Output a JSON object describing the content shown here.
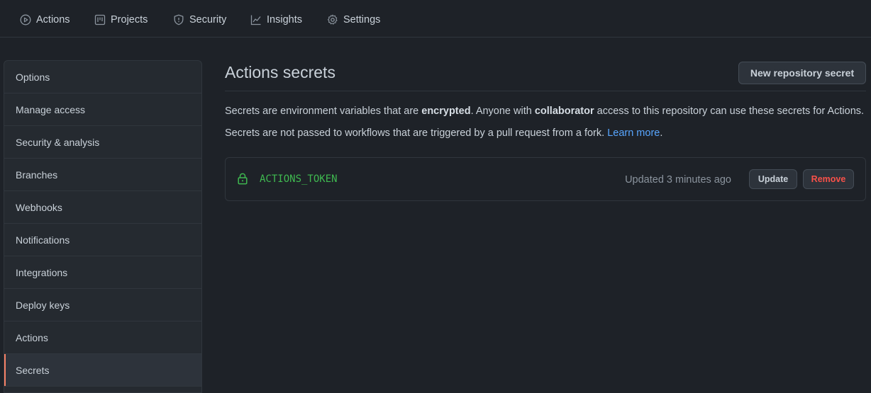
{
  "topnav": {
    "tabs": [
      {
        "label": "Actions",
        "icon": "play-circle-icon"
      },
      {
        "label": "Projects",
        "icon": "project-board-icon"
      },
      {
        "label": "Security",
        "icon": "shield-icon"
      },
      {
        "label": "Insights",
        "icon": "graph-icon"
      },
      {
        "label": "Settings",
        "icon": "gear-icon"
      }
    ]
  },
  "sidebar": {
    "items": [
      {
        "label": "Options"
      },
      {
        "label": "Manage access"
      },
      {
        "label": "Security & analysis"
      },
      {
        "label": "Branches"
      },
      {
        "label": "Webhooks"
      },
      {
        "label": "Notifications"
      },
      {
        "label": "Integrations"
      },
      {
        "label": "Deploy keys"
      },
      {
        "label": "Actions"
      },
      {
        "label": "Secrets",
        "selected": true
      }
    ]
  },
  "main": {
    "title": "Actions secrets",
    "new_secret_label": "New repository secret",
    "description1": {
      "part1": "Secrets are environment variables that are ",
      "bold1": "encrypted",
      "part2": ". Anyone with ",
      "bold2": "collaborator",
      "part3": " access to this repository can use these secrets for Actions."
    },
    "description2": {
      "text": "Secrets are not passed to workflows that are triggered by a pull request from a fork. ",
      "link": "Learn more",
      "end": "."
    },
    "secrets": [
      {
        "name": "ACTIONS_TOKEN",
        "updated": "Updated 3 minutes ago",
        "update_label": "Update",
        "remove_label": "Remove"
      }
    ]
  },
  "colors": {
    "background": "#1e2228",
    "accent_selected": "#f78166",
    "link": "#58a6ff",
    "secret_name": "#3fb950",
    "danger": "#f85149"
  }
}
